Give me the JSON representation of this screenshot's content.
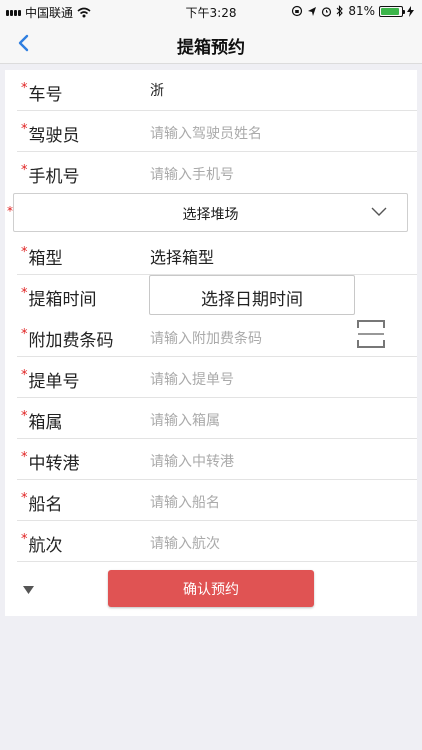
{
  "status_bar": {
    "carrier": "中国联通",
    "time": "下午3:28",
    "battery": "81%",
    "battery_level": 0.81,
    "battery_color": "#3cb54a"
  },
  "nav": {
    "title": "提箱预约",
    "back_icon": "chevron-left-icon"
  },
  "form": {
    "required_mark": "*",
    "truck_no": {
      "label": "车号",
      "value": "浙"
    },
    "driver": {
      "label": "驾驶员",
      "placeholder": "请输入驾驶员姓名"
    },
    "phone": {
      "label": "手机号",
      "placeholder": "请输入手机号"
    },
    "yard": {
      "value": "选择堆场"
    },
    "box_type": {
      "label": "箱型",
      "value": "选择箱型"
    },
    "pickup_time": {
      "label": "提箱时间",
      "button": "选择日期时间"
    },
    "surcharge_code": {
      "label": "附加费条码",
      "placeholder": "请输入附加费条码"
    },
    "bill_no": {
      "label": "提单号",
      "placeholder": "请输入提单号"
    },
    "box_owner": {
      "label": "箱属",
      "placeholder": "请输入箱属"
    },
    "transit_port": {
      "label": "中转港",
      "placeholder": "请输入中转港"
    },
    "vessel": {
      "label": "船名",
      "placeholder": "请输入船名"
    },
    "voyage": {
      "label": "航次",
      "placeholder": "请输入航次"
    },
    "confirm_button": "确认预约"
  },
  "colors": {
    "accent": "#2f7fe0",
    "confirm": "#e05353",
    "required": "#e02020"
  }
}
